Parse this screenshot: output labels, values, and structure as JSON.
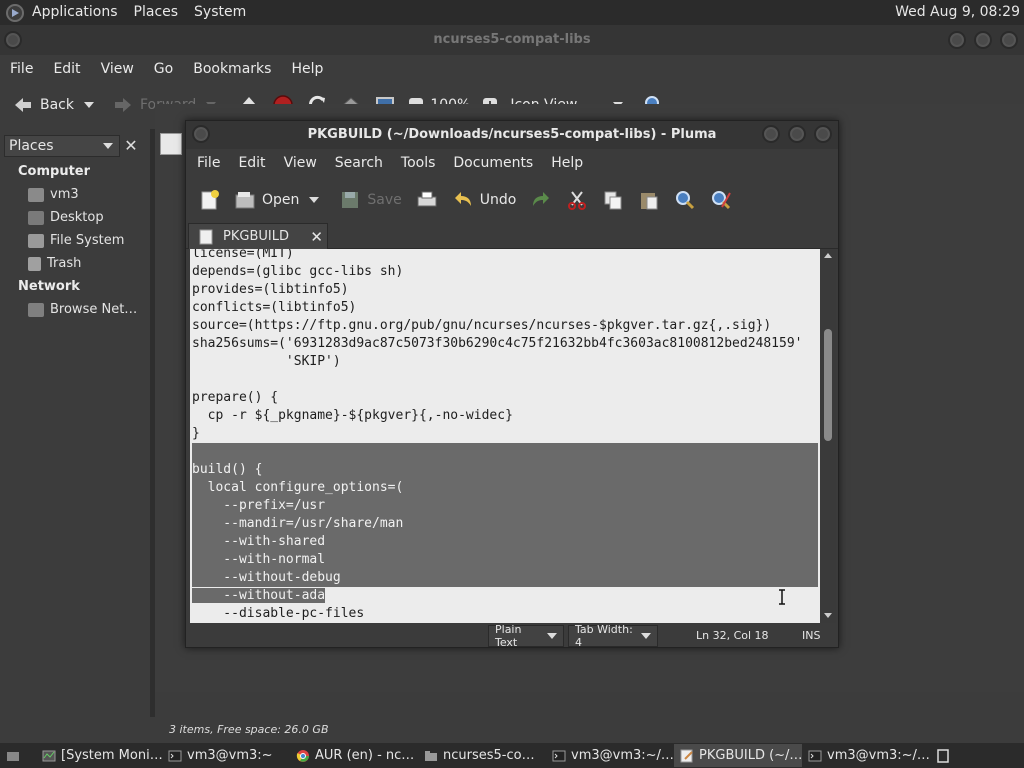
{
  "top_panel": {
    "menus": [
      "Applications",
      "Places",
      "System"
    ],
    "clock": "Wed Aug  9, 08:29"
  },
  "caja": {
    "title": "ncurses5-compat-libs",
    "menus": [
      "File",
      "Edit",
      "View",
      "Go",
      "Bookmarks",
      "Help"
    ],
    "toolbar": {
      "back": "Back",
      "forward": "Forward",
      "zoom": "100%",
      "view_mode": "Icon View"
    },
    "sidebar": {
      "selector": "Places",
      "close": "✕",
      "sections": [
        {
          "heading": "Computer",
          "items": [
            "vm3",
            "Desktop",
            "File System",
            "Trash"
          ]
        },
        {
          "heading": "Network",
          "items": [
            "Browse Net…"
          ]
        }
      ]
    },
    "status": "3 items, Free space: 26.0 GB"
  },
  "pluma": {
    "title": "PKGBUILD (~/Downloads/ncurses5-compat-libs) - Pluma",
    "menus": [
      "File",
      "Edit",
      "View",
      "Search",
      "Tools",
      "Documents",
      "Help"
    ],
    "toolbar": {
      "open": "Open",
      "save": "Save",
      "undo": "Undo"
    },
    "tab": {
      "label": "PKGBUILD",
      "close": "✕"
    },
    "code": [
      "license=(MIT)",
      "depends=(glibc gcc-libs sh)",
      "provides=(libtinfo5)",
      "conflicts=(libtinfo5)",
      "source=(https://ftp.gnu.org/pub/gnu/ncurses/ncurses-$pkgver.tar.gz{,.sig})",
      "sha256sums=('6931283d9ac87c5073f30b6290c4c75f21632bb4fc3603ac8100812bed248159'",
      "            'SKIP')",
      "",
      "prepare() {",
      "  cp -r ${_pkgname}-${pkgver}{,-no-widec}",
      "}",
      "",
      "build() {",
      "  local configure_options=(",
      "    --prefix=/usr",
      "    --mandir=/usr/share/man",
      "    --with-shared",
      "    --with-normal",
      "    --without-debug",
      "    --without-ada",
      "    --disable-pc-files"
    ],
    "status": {
      "language": "Plain Text",
      "tab_width": "Tab Width:  4",
      "position": "Ln 32, Col 18",
      "mode": "INS"
    }
  },
  "taskbar": [
    {
      "label": "[System Moni…",
      "active": false
    },
    {
      "label": "vm3@vm3:~",
      "active": false
    },
    {
      "label": "AUR (en) - nc…",
      "active": false
    },
    {
      "label": "ncurses5-co…",
      "active": false
    },
    {
      "label": "vm3@vm3:~/…",
      "active": false
    },
    {
      "label": "PKGBUILD (~/…",
      "active": true
    },
    {
      "label": "vm3@vm3:~/…",
      "active": false
    }
  ],
  "colors": {
    "panel": "#2b2b2b",
    "window": "#3c3c3c",
    "editor_bg": "#ececec",
    "selection": "#6a6a6a"
  }
}
